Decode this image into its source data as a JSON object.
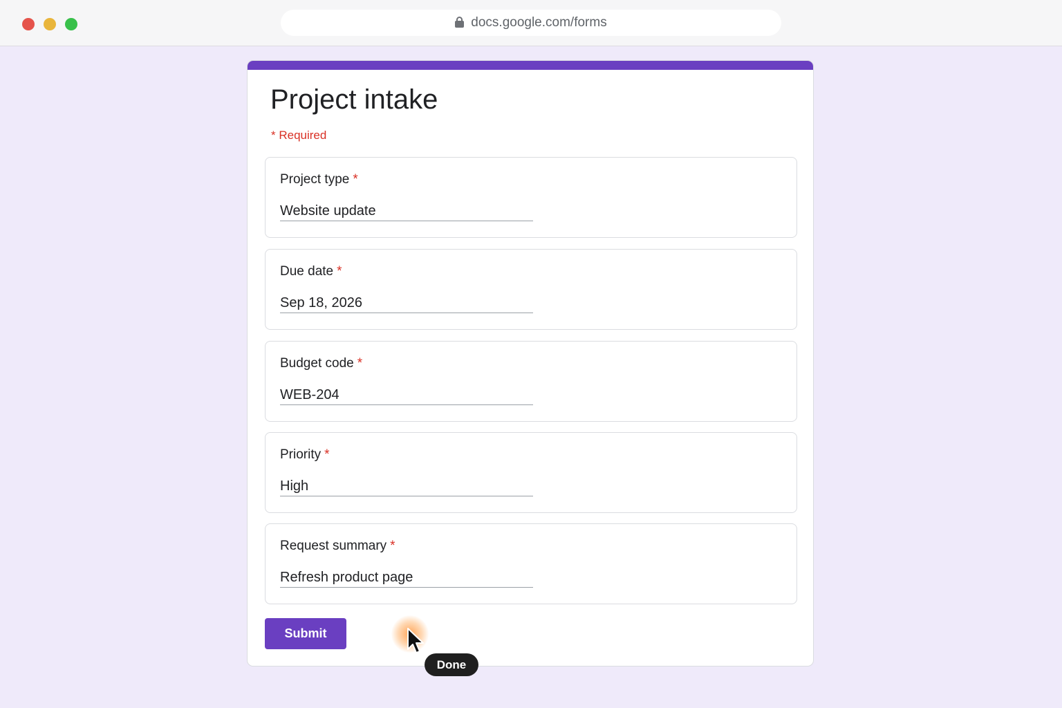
{
  "browser": {
    "url": "docs.google.com/forms"
  },
  "form": {
    "title": "Project intake",
    "required_note": "* Required",
    "questions": [
      {
        "label": "Project type",
        "required_mark": "*",
        "value": "Website update"
      },
      {
        "label": "Due date",
        "required_mark": "*",
        "value": "Sep 18, 2026"
      },
      {
        "label": "Budget code",
        "required_mark": "*",
        "value": "WEB-204"
      },
      {
        "label": "Priority",
        "required_mark": "*",
        "value": "High"
      },
      {
        "label": "Request summary",
        "required_mark": "*",
        "value": "Refresh product page"
      }
    ],
    "submit_label": "Submit"
  },
  "overlay": {
    "tooltip": "Done"
  },
  "colors": {
    "accent": "#6a3fc1",
    "required": "#d93025",
    "page_background": "#efeafa"
  },
  "icons": {
    "lock": "lock-icon",
    "cursor": "mouse-pointer-icon"
  }
}
